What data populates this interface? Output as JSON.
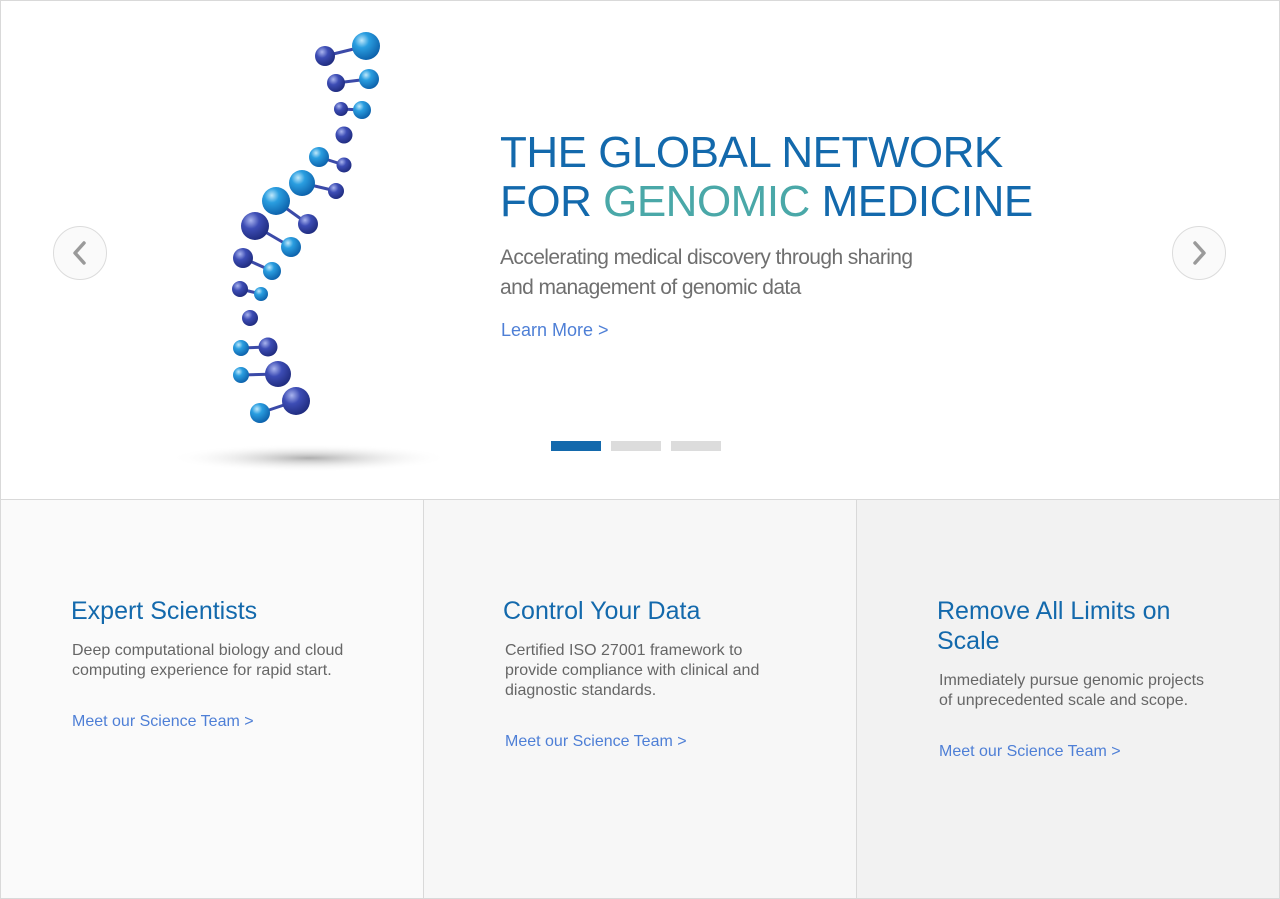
{
  "hero": {
    "headline_line1": "THE GLOBAL NETWORK",
    "headline_line2_prefix": "FOR ",
    "headline_line2_accent": "GENOMIC",
    "headline_line2_suffix": " MEDICINE",
    "subtitle": "Accelerating medical discovery through sharing and management of genomic data",
    "cta": "Learn More >",
    "slides_total": 3,
    "active_slide": 1,
    "prev_icon": "chevron-left-icon",
    "next_icon": "chevron-right-icon"
  },
  "features": [
    {
      "title": "Expert Scientists",
      "body": "Deep computational biology and cloud computing experience for rapid start.",
      "link": "Meet our Science Team >"
    },
    {
      "title": "Control Your Data",
      "body": "Certified ISO 27001 framework to provide compliance with clinical and diagnostic standards.",
      "link": "Meet our Science Team >"
    },
    {
      "title": "Remove All Limits on Scale",
      "body": "Immediately pursue genomic projects of unprecedented scale and scope.",
      "link": "Meet our Science Team >"
    }
  ],
  "colors": {
    "primary": "#1369ac",
    "accent": "#4aa8a8",
    "link": "#4e7fd6",
    "muted_text": "#6f6f6f"
  }
}
